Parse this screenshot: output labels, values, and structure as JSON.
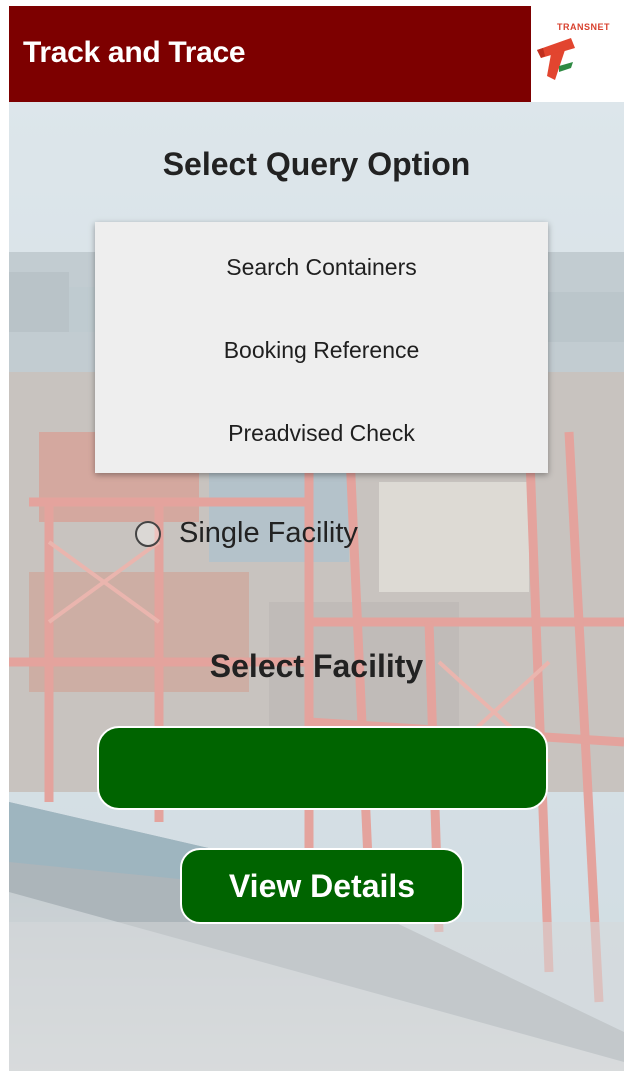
{
  "header": {
    "title": "Track and Trace",
    "logo_text": "TRANSNET",
    "background_color": "#7d0000"
  },
  "query": {
    "title": "Select Query Option",
    "options": [
      {
        "label": "Search Containers"
      },
      {
        "label": "Booking Reference"
      },
      {
        "label": "Preadvised Check"
      }
    ]
  },
  "facility": {
    "radio_label": "Single Facility",
    "radio_checked": false,
    "title": "Select Facility",
    "selected_value": ""
  },
  "actions": {
    "view_details_label": "View Details",
    "button_color": "#006400"
  },
  "icons": {
    "logo": "transnet-logo-icon",
    "radio": "radio-unchecked-icon"
  }
}
